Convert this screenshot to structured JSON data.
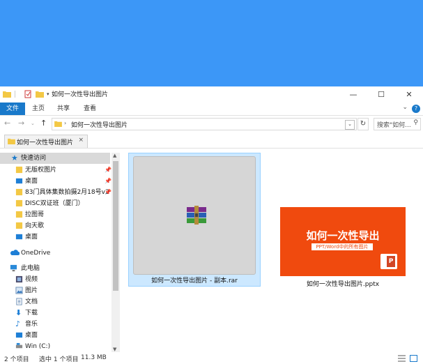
{
  "window": {
    "title": "如何一次性导出图片"
  },
  "ribbon": {
    "tabs": [
      "文件",
      "主页",
      "共享",
      "查看"
    ],
    "help": "?"
  },
  "address": {
    "path": "如何一次性导出图片",
    "search_placeholder": "搜索\"如何...",
    "refresh_glyph": "↻",
    "dropdown_glyph": "⌄"
  },
  "tab": {
    "label": "如何一次性导出图片",
    "close": "×"
  },
  "nav": {
    "quick_access": "快速访问",
    "pinned": [
      "无版权图片",
      "桌面",
      "83门具体集数拍摄2月18号v2",
      "DISC双证班（厦门）",
      "拉图哥",
      "向天歌",
      "桌面"
    ],
    "onedrive": "OneDrive",
    "this_pc": "此电脑",
    "pc_items": [
      "视频",
      "图片",
      "文档",
      "下载",
      "音乐",
      "桌面",
      "Win (C:)"
    ]
  },
  "files": [
    {
      "name": "如何一次性导出图片 - 副本.rar",
      "selected": true,
      "icon": "winrar-icon"
    },
    {
      "name": "如何一次性导出图片.pptx",
      "selected": false,
      "icon": "pptx-thumbnail",
      "thumb_title": "如何一次性导出",
      "thumb_subtitle": "PPT/Word中的所有图片"
    }
  ],
  "status": {
    "count": "2 个项目",
    "selection": "选中 1 个项目",
    "size": "11.3 MB"
  },
  "colors": {
    "desktop": "#3c97f7",
    "accent": "#1979ca",
    "selected_bg": "#cce8ff",
    "ppt": "#f04a0e"
  }
}
